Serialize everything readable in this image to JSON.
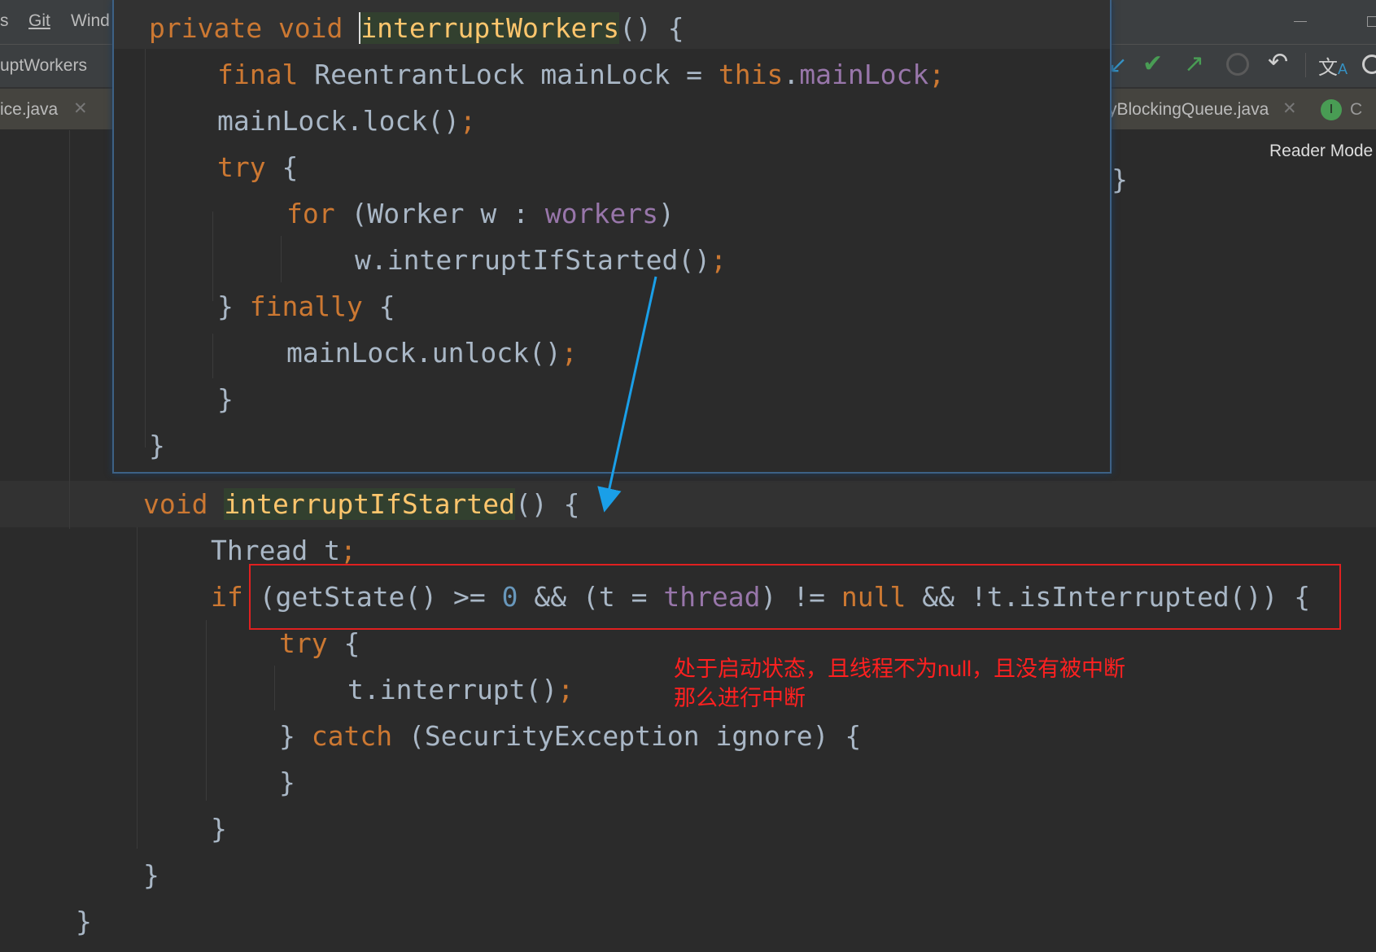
{
  "menu": {
    "items": [
      "s",
      "Git",
      "Wind"
    ]
  },
  "toolbar": {
    "breadcrumb": "uptWorkers",
    "icons": [
      "vcs-update-icon",
      "commit-check-icon",
      "push-arrow-icon",
      "history-clock-icon",
      "rollback-icon",
      "translate-icon",
      "search-icon"
    ]
  },
  "tabs": [
    {
      "label": "ice.java"
    },
    {
      "label": "yBlockingQueue.java"
    },
    {
      "label": "C"
    }
  ],
  "reader_mode": "Reader Mode",
  "popup": {
    "lines": [
      [
        "private void ",
        "interruptWorkers",
        "() {"
      ],
      [
        "final ",
        "ReentrantLock mainLock = ",
        "this",
        ".",
        "mainLock",
        ";"
      ],
      [
        "mainLock.lock()",
        ";"
      ],
      [
        "try",
        " {"
      ],
      [
        "for",
        " (Worker w : ",
        "workers",
        ")"
      ],
      [
        "w.interruptIfStarted()",
        ";"
      ],
      [
        "} ",
        "finally",
        " {"
      ],
      [
        "mainLock.unlock()",
        ";"
      ],
      [
        "}"
      ],
      [
        "}"
      ]
    ]
  },
  "code": {
    "lines": [
      [
        "void ",
        "interruptIfStarted",
        "() {"
      ],
      [
        "Thread t",
        ";"
      ],
      [
        "if",
        " (getState() >= ",
        "0",
        " && (t = ",
        "thread",
        ") != ",
        "null",
        " && !t.isInterrupted()) {"
      ],
      [
        "try",
        " {"
      ],
      [
        "t.interrupt()",
        ";"
      ],
      [
        "} ",
        "catch",
        " (SecurityException ignore) {"
      ],
      [
        "}"
      ],
      [
        "}"
      ],
      [
        "}"
      ],
      [
        "}"
      ]
    ],
    "right_brace": "}"
  },
  "annotation": {
    "line1": "处于启动状态，且线程不为null，且没有被中断",
    "line2": "那么进行中断",
    "box_color": "#e02020",
    "arrow_color": "#1a9fe8"
  }
}
